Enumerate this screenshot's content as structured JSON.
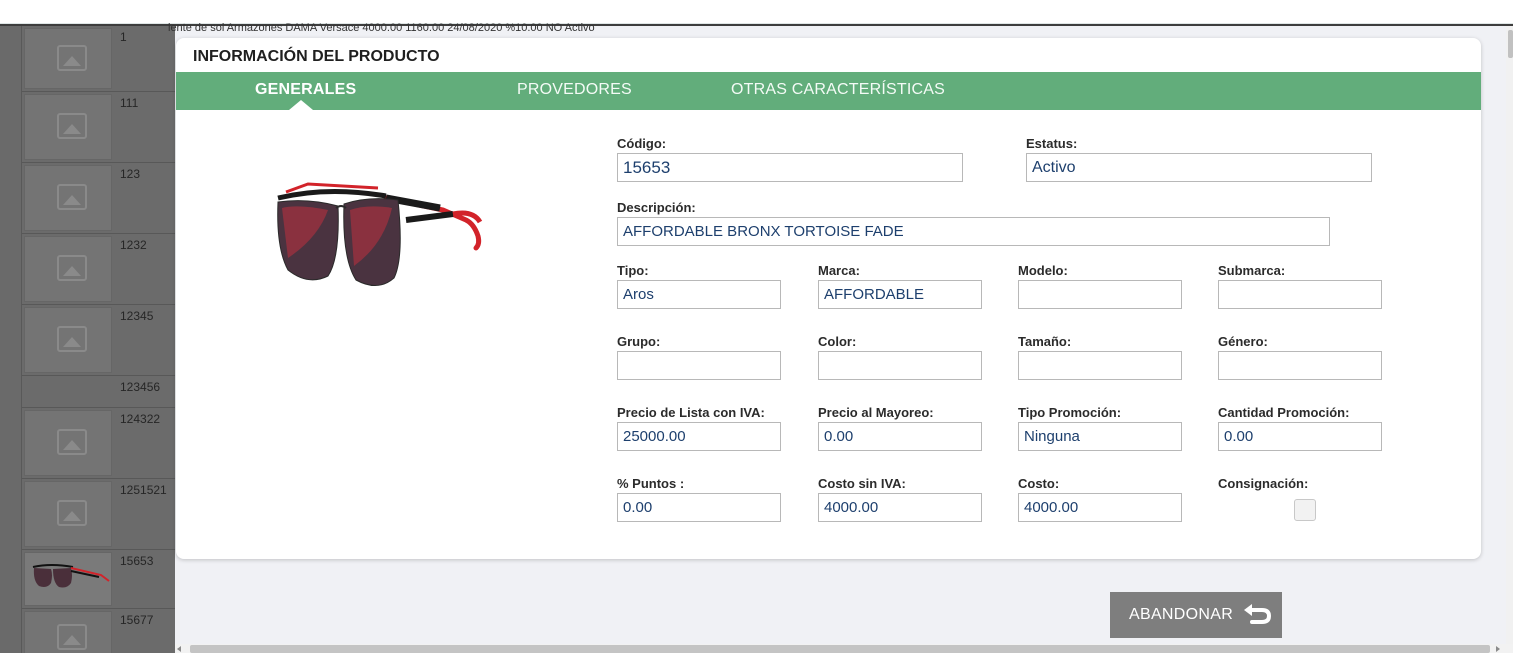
{
  "background": {
    "header_fragment": "lente de sol    Armazones  DAMA       Versace                                                                4000.00  1160.00  24/08/2020     %10.00       NO        Activo",
    "rows": [
      {
        "code": "1",
        "has_image": false
      },
      {
        "code": "111",
        "has_image": false
      },
      {
        "code": "123",
        "has_image": false
      },
      {
        "code": "1232",
        "has_image": false
      },
      {
        "code": "12345",
        "has_image": false
      },
      {
        "code": "123456",
        "has_image": false
      },
      {
        "code": "124322",
        "has_image": false
      },
      {
        "code": "1251521",
        "has_image": false
      },
      {
        "code": "15653",
        "has_image": true
      },
      {
        "code": "15677",
        "has_image": false
      }
    ]
  },
  "modal": {
    "title": "INFORMACIÓN DEL PRODUCTO",
    "tabs": [
      {
        "label": "GENERALES",
        "active": true
      },
      {
        "label": "PROVEDORES",
        "active": false
      },
      {
        "label": "OTRAS CARACTERÍSTICAS",
        "active": false
      }
    ],
    "fields": {
      "codigo": {
        "label": "Código:",
        "value": "15653"
      },
      "estatus": {
        "label": "Estatus:",
        "value": "Activo"
      },
      "descripcion": {
        "label": "Descripción:",
        "value": "AFFORDABLE BRONX TORTOISE FADE"
      },
      "tipo": {
        "label": "Tipo:",
        "value": "Aros"
      },
      "marca": {
        "label": "Marca:",
        "value": "AFFORDABLE"
      },
      "modelo": {
        "label": "Modelo:",
        "value": ""
      },
      "submarca": {
        "label": "Submarca:",
        "value": ""
      },
      "grupo": {
        "label": "Grupo:",
        "value": ""
      },
      "color": {
        "label": "Color:",
        "value": ""
      },
      "tamano": {
        "label": "Tamaño:",
        "value": ""
      },
      "genero": {
        "label": "Género:",
        "value": ""
      },
      "precio_lista": {
        "label": "Precio de Lista con IVA:",
        "value": "25000.00"
      },
      "precio_mayoreo": {
        "label": "Precio al Mayoreo:",
        "value": "0.00"
      },
      "tipo_promocion": {
        "label": "Tipo Promoción:",
        "value": "Ninguna"
      },
      "cantidad_promocion": {
        "label": "Cantidad Promoción:",
        "value": "0.00"
      },
      "puntos": {
        "label": "% Puntos :",
        "value": "0.00"
      },
      "costo_sin_iva": {
        "label": "Costo sin IVA:",
        "value": "4000.00"
      },
      "costo": {
        "label": "Costo:",
        "value": "4000.00"
      },
      "consignacion": {
        "label": "Consignación:",
        "checked": false
      }
    }
  },
  "actions": {
    "abandon_label": "ABANDONAR"
  },
  "colors": {
    "tab_bar": "#62ad7b",
    "input_text": "#1d3f6d",
    "abandon_button": "#7e7e7e"
  }
}
